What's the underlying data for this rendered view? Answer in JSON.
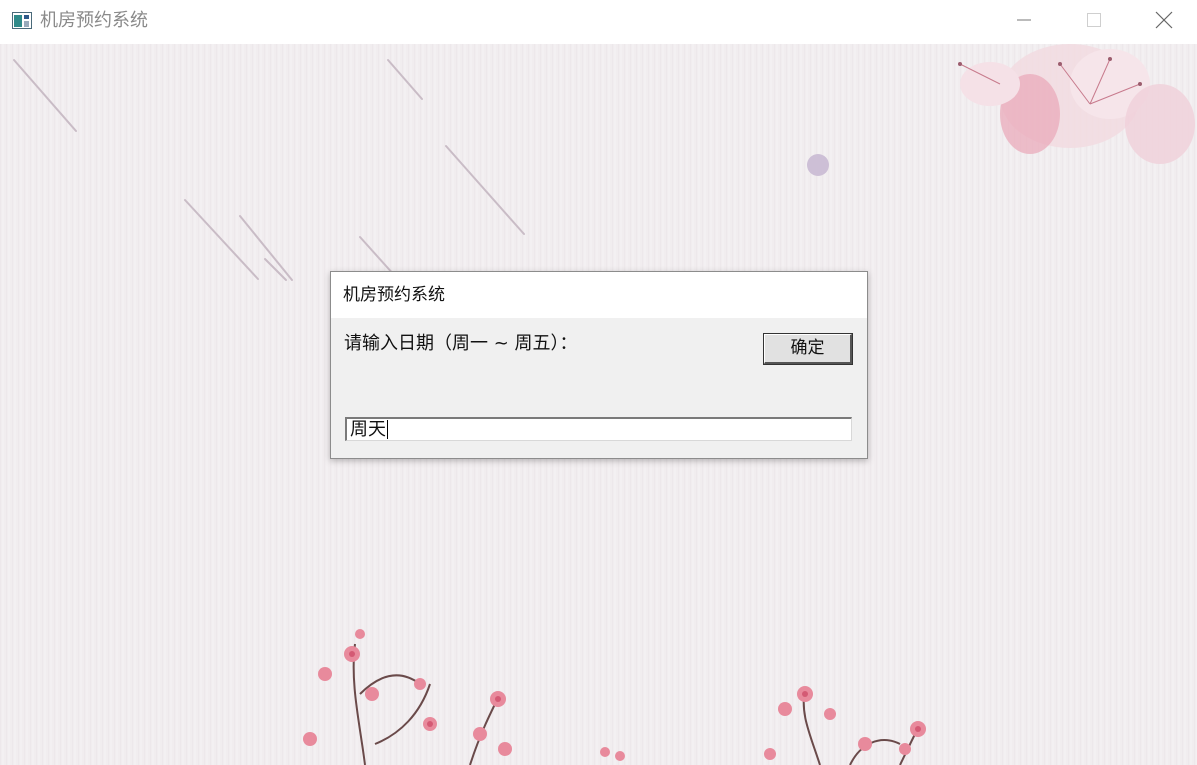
{
  "window": {
    "title": "机房预约系统",
    "icon": "app-window-icon",
    "controls": [
      "minimize-icon",
      "maximize-icon",
      "close-icon"
    ]
  },
  "dialog": {
    "title": "机房预约系统",
    "prompt": "请输入日期（周一 ~ 周五）：",
    "ok_label": "确定",
    "input_value": "周天"
  },
  "colors": {
    "background": "#f1edef",
    "dialog_bg": "#f0f0f0",
    "flower_pink": "#e89aa8"
  }
}
